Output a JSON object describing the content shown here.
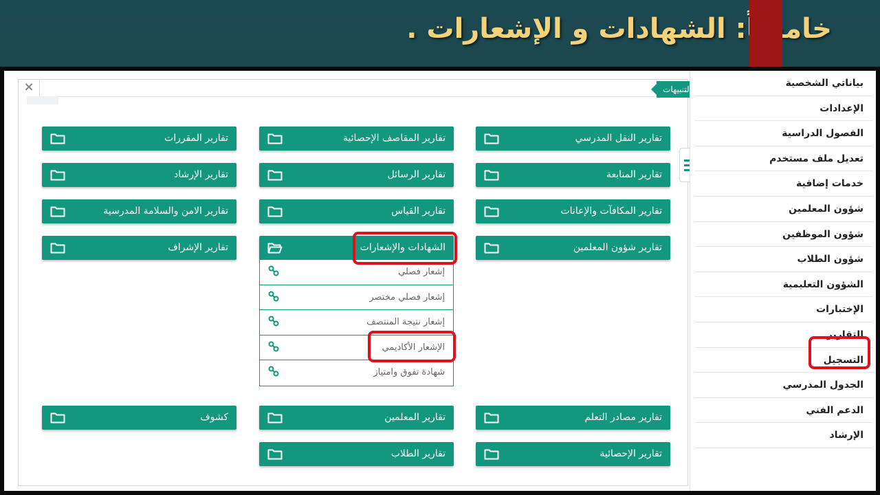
{
  "slide": {
    "title": "خامساً: الشهادات و الإشعارات ."
  },
  "panel": {
    "close": "×",
    "notifications": "التنبيهات"
  },
  "sidebar": {
    "items": [
      "بياناتي الشخصية",
      "الإعدادات",
      "الفصول الدراسية",
      "تعديل ملف مستخدم",
      "خدمات إضافية",
      "شؤون المعلمين",
      "شؤون الموظفين",
      "شؤون الطلاب",
      "الشؤون التعليمية",
      "الإختبارات",
      "التقارير",
      "التسجيل",
      "الجدول المدرسي",
      "الدعم الفني",
      "الإرشاد"
    ]
  },
  "reports": {
    "r1": "تقارير النقل المدرسي",
    "r2": "تقارير المقاصف الإحصائية",
    "r3": "تقارير المقررات",
    "r4": "تقارير المتابعة",
    "r5": "تقارير الرسائل",
    "r6": "تقارير الإرشاد",
    "r7": "تقارير المكافآت والإعانات",
    "r8": "تقارير القياس",
    "r9": "تقارير الامن والسلامة المدرسية",
    "r10": "تقارير شؤون المعلمين",
    "r11": "الشهادات والإشعارات",
    "r12": "تقارير الإشراف",
    "r13": "تقارير مصادر التعلم",
    "r14": "تقارير المعلمين",
    "r15": "كشوف",
    "r16": "تقارير الإحصائية",
    "r17": "تقارير الطلاب"
  },
  "certificates": {
    "items": [
      "إشعار فصلي",
      "إشعار فصلي مختصر",
      "إشعار نتيجة المنتصف",
      "الإشعار الأكاديمي",
      "شهادة تفوق وامتياز"
    ]
  },
  "colors": {
    "accent": "#13977f",
    "highlight": "#e0101c",
    "title": "#f3d27a"
  }
}
